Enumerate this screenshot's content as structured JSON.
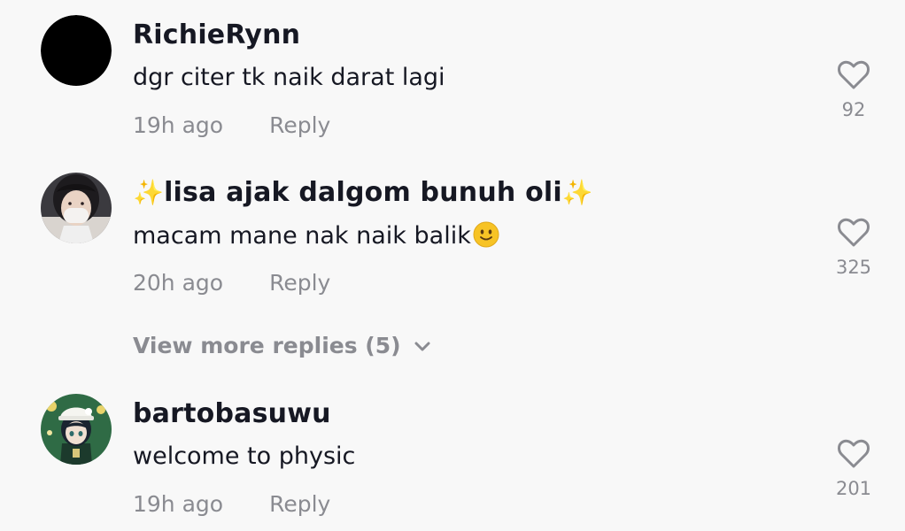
{
  "comments": [
    {
      "username": "RichieRynn",
      "text": "dgr citer tk naik darat lagi",
      "time": "19h ago",
      "reply_label": "Reply",
      "likes": "92",
      "avatar": "black-circle-avatar"
    },
    {
      "username": "lisa ajak dalgom bunuh oli",
      "username_prefix_emoji": "✨",
      "username_suffix_emoji": "✨",
      "text": "macam mane nak naik balik",
      "text_emoji": "slightly-smiling-face",
      "time": "20h ago",
      "reply_label": "Reply",
      "likes": "325",
      "avatar": "person-with-mask-avatar",
      "view_more_replies": "View more replies (5)"
    },
    {
      "username": "bartobasuwu",
      "text": "welcome to physic",
      "time": "19h ago",
      "reply_label": "Reply",
      "likes": "201",
      "avatar": "anime-character-avatar"
    }
  ],
  "icons": {
    "like": "heart-outline-icon",
    "expand": "chevron-down-icon"
  },
  "colors": {
    "background": "#f8f8f8",
    "primary_text": "#161823",
    "secondary_text": "#8a8b91",
    "icon": "#8a8b91",
    "sparkle": "#f5c518"
  }
}
